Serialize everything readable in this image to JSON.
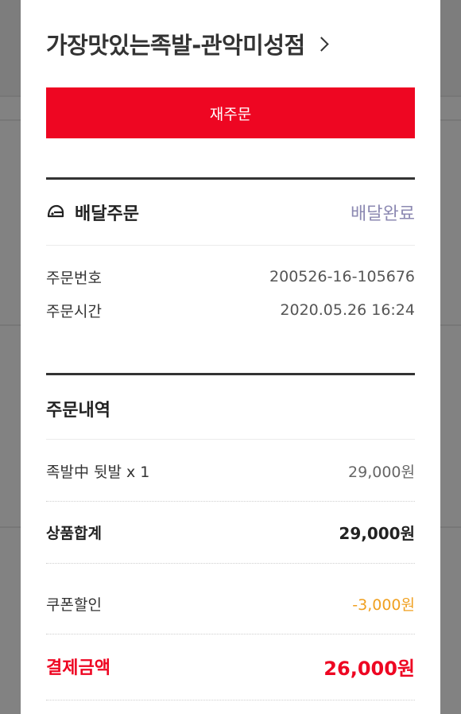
{
  "store": {
    "name": "가장맛있는족발-관악미성점"
  },
  "reorder_button": {
    "label": "재주문"
  },
  "delivery": {
    "type_label": "배달주문",
    "status": "배달완료",
    "icon": "helmet-icon"
  },
  "order_info": {
    "number_label": "주문번호",
    "number_value": "200526-16-105676",
    "time_label": "주문시간",
    "time_value": "2020.05.26 16:24"
  },
  "order_details": {
    "title": "주문내역",
    "items": [
      {
        "name": "족발中 뒷발 x 1",
        "price": "29,000원"
      }
    ],
    "subtotal_label": "상품합계",
    "subtotal_value": "29,000원",
    "coupon_label": "쿠폰할인",
    "coupon_value": "-3,000원",
    "total_label": "결제금액",
    "total_value": "26,000원"
  },
  "colors": {
    "accent": "#ee0622",
    "status": "#8c89b2",
    "discount": "#f0a020"
  }
}
